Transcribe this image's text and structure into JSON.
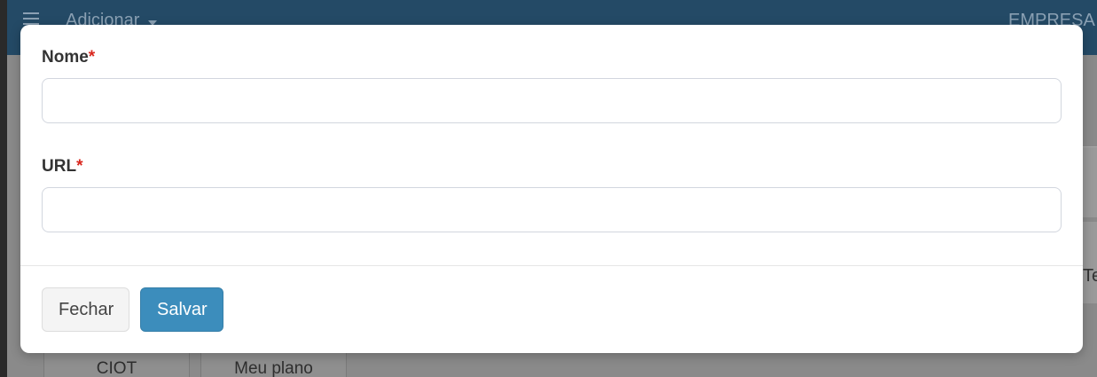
{
  "app": {
    "add_menu_label": "Adicionar",
    "company_label": "EMPRESA P",
    "right_edge_text": "Te",
    "cards": [
      {
        "label": "CIOT"
      },
      {
        "label": "Meu plano"
      }
    ]
  },
  "modal": {
    "fields": [
      {
        "label": "Nome",
        "required_mark": "*",
        "value": ""
      },
      {
        "label": "URL",
        "required_mark": "*",
        "value": ""
      }
    ],
    "footer": {
      "close_label": "Fechar",
      "save_label": "Salvar"
    }
  },
  "colors": {
    "header_bg": "#244a66",
    "primary_button": "#3c8dbc",
    "required_mark": "#d9271e"
  }
}
